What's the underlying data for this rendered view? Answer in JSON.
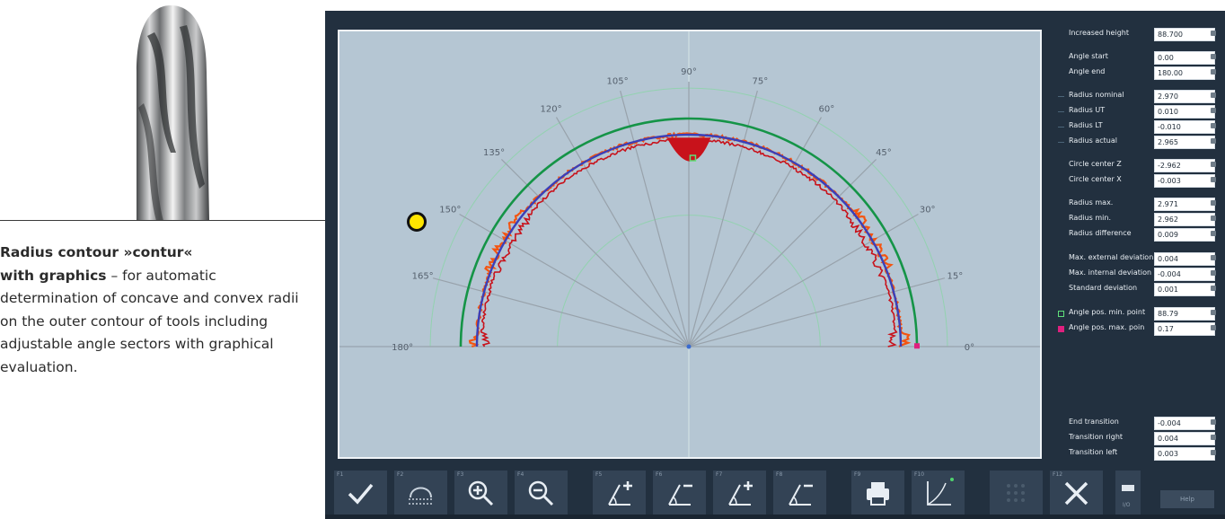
{
  "caption": {
    "highlight_line1": "Radius contour »contur«",
    "highlight_line2": "with graphics",
    "rest": " – for automatic determination of concave and convex radii on the outer contour of tools including adjustable angle sectors with graphical evaluation."
  },
  "plot": {
    "angle_labels": [
      "0°",
      "15°",
      "30°",
      "45°",
      "60°",
      "75°",
      "90°",
      "105°",
      "120°",
      "135°",
      "150°",
      "165°",
      "180°"
    ],
    "colors": {
      "background": "#b5c6d3",
      "tolerance_circle": "#159447",
      "nominal_contour": "#3b3fb8",
      "deviation_outer": "#f45410",
      "deviation_inner": "#c8121b",
      "min_point_marker": "#5fe07a",
      "max_point_marker": "#e0207f",
      "callout_marker": "#ffe600"
    }
  },
  "params": [
    {
      "label": "Increased height",
      "value": "88.700",
      "marker": "none"
    },
    {
      "label": "Angle start",
      "value": "0.00",
      "marker": "none"
    },
    {
      "label": "Angle end",
      "value": "180.00",
      "marker": "none"
    },
    {
      "label": "Radius nominal",
      "value": "2.970",
      "marker": "dash"
    },
    {
      "label": "Radius UT",
      "value": "0.010",
      "marker": "dash"
    },
    {
      "label": "Radius LT",
      "value": "-0.010",
      "marker": "dash"
    },
    {
      "label": "Radius actual",
      "value": "2.965",
      "marker": "dash"
    },
    {
      "label": "Circle center Z",
      "value": "-2.962",
      "marker": "none"
    },
    {
      "label": "Circle center X",
      "value": "-0.003",
      "marker": "none"
    },
    {
      "label": "Radius max.",
      "value": "2.971",
      "marker": "none"
    },
    {
      "label": "Radius min.",
      "value": "2.962",
      "marker": "none"
    },
    {
      "label": "Radius difference",
      "value": "0.009",
      "marker": "none"
    },
    {
      "label": "Max. external deviation",
      "value": "0.004",
      "marker": "none"
    },
    {
      "label": "Max. internal deviation",
      "value": "-0.004",
      "marker": "none"
    },
    {
      "label": "Standard deviation",
      "value": "0.001",
      "marker": "none"
    },
    {
      "label": "Angle pos. min. point",
      "value": "88.79",
      "marker": "sq-green"
    },
    {
      "label": "Angle pos. max. poin",
      "value": "0.17",
      "marker": "sq-mag"
    },
    {
      "label": "End transition",
      "value": "-0.004",
      "marker": "none"
    },
    {
      "label": "Transition right",
      "value": "0.004",
      "marker": "none"
    },
    {
      "label": "Transition left",
      "value": "0.003",
      "marker": "none"
    }
  ],
  "toolbar": {
    "keys": [
      "F1",
      "F2",
      "F3",
      "F4",
      "F5",
      "F6",
      "F7",
      "F8",
      "F9",
      "F10",
      "F12"
    ],
    "help_label": "Help",
    "small_label": "I/O"
  }
}
